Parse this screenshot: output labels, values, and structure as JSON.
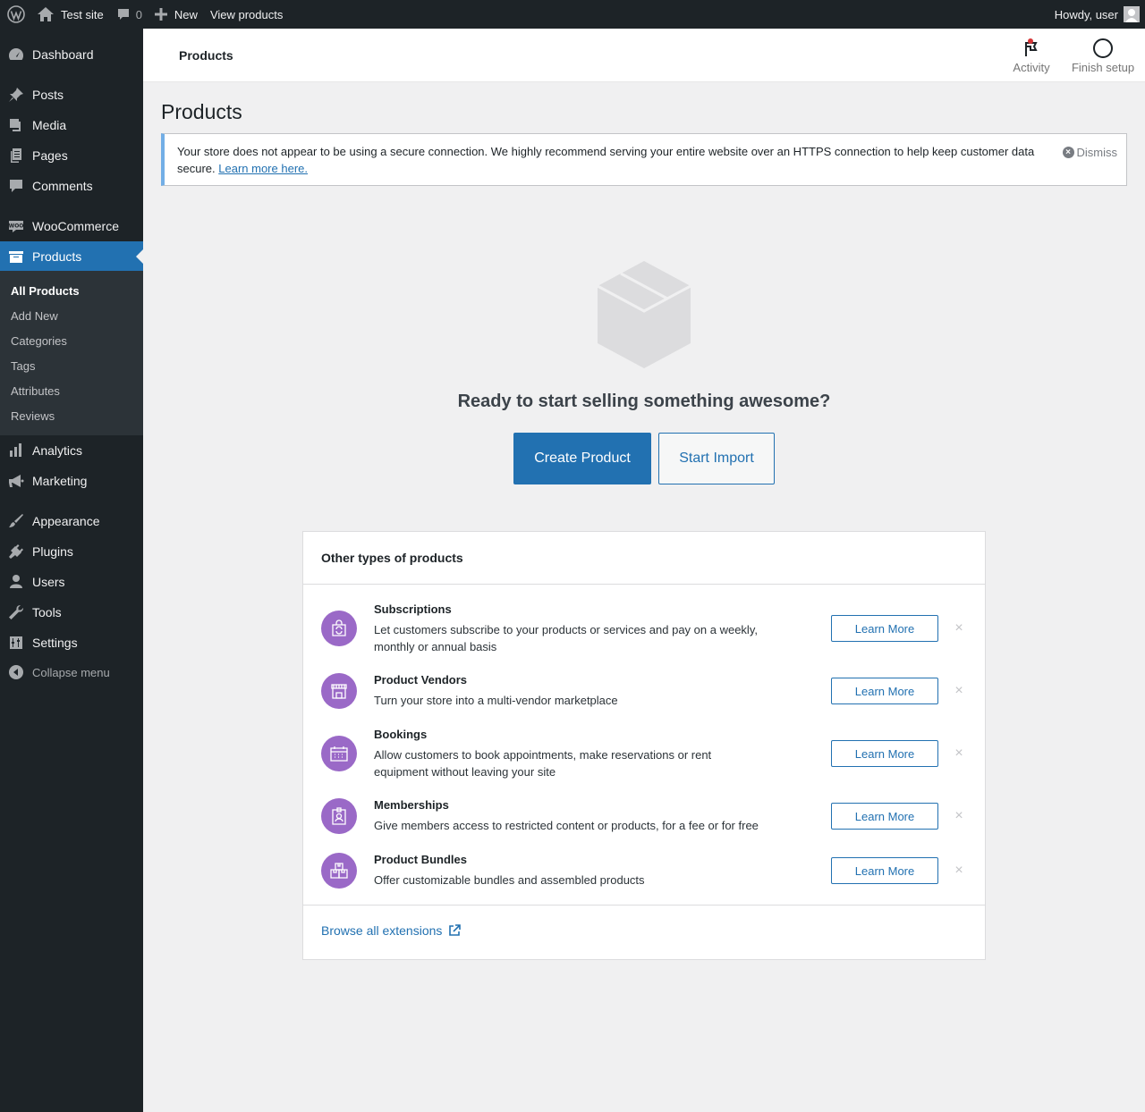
{
  "admin_bar": {
    "site_name": "Test site",
    "comments_count": "0",
    "new_label": "New",
    "view_label": "View products",
    "howdy": "Howdy, user"
  },
  "sidebar": {
    "items": [
      {
        "label": "Dashboard",
        "icon": "dashboard-icon"
      },
      {
        "label": "Posts",
        "icon": "pin-icon"
      },
      {
        "label": "Media",
        "icon": "media-icon"
      },
      {
        "label": "Pages",
        "icon": "pages-icon"
      },
      {
        "label": "Comments",
        "icon": "comment-icon"
      },
      {
        "label": "WooCommerce",
        "icon": "woo-icon"
      },
      {
        "label": "Products",
        "icon": "archive-icon"
      },
      {
        "label": "Analytics",
        "icon": "bar-chart-icon"
      },
      {
        "label": "Marketing",
        "icon": "megaphone-icon"
      },
      {
        "label": "Appearance",
        "icon": "brush-icon"
      },
      {
        "label": "Plugins",
        "icon": "plug-icon"
      },
      {
        "label": "Users",
        "icon": "user-icon"
      },
      {
        "label": "Tools",
        "icon": "wrench-icon"
      },
      {
        "label": "Settings",
        "icon": "sliders-icon"
      }
    ],
    "submenu": [
      "All Products",
      "Add New",
      "Categories",
      "Tags",
      "Attributes",
      "Reviews"
    ],
    "collapse_label": "Collapse menu"
  },
  "header": {
    "title": "Products",
    "activity_label": "Activity",
    "finish_setup_label": "Finish setup"
  },
  "page": {
    "title": "Products",
    "notice_text": "Your store does not appear to be using a secure connection. We highly recommend serving your entire website over an HTTPS connection to help keep customer data secure.",
    "notice_link": "Learn more here.",
    "dismiss_label": "Dismiss",
    "empty_heading": "Ready to start selling something awesome?",
    "create_label": "Create Product",
    "import_label": "Start Import"
  },
  "extensions": {
    "title": "Other types of products",
    "items": [
      {
        "title": "Subscriptions",
        "desc": "Let customers subscribe to your products or services and pay on a weekly, monthly or annual basis",
        "button": "Learn More",
        "icon": "subscription-bag-icon"
      },
      {
        "title": "Product Vendors",
        "desc": "Turn your store into a multi-vendor marketplace",
        "button": "Learn More",
        "icon": "storefront-icon"
      },
      {
        "title": "Bookings",
        "desc": "Allow customers to book appointments, make reservations or rent equipment without leaving your site",
        "button": "Learn More",
        "icon": "calendar-icon"
      },
      {
        "title": "Memberships",
        "desc": "Give members access to restricted content or products, for a fee or for free",
        "button": "Learn More",
        "icon": "badge-icon"
      },
      {
        "title": "Product Bundles",
        "desc": "Offer customizable bundles and assembled products",
        "button": "Learn More",
        "icon": "bundle-icon"
      }
    ],
    "browse_label": "Browse all extensions"
  },
  "colors": {
    "admin_dark": "#1d2327",
    "accent": "#2271b1",
    "extension_purple": "#9a69c7"
  }
}
